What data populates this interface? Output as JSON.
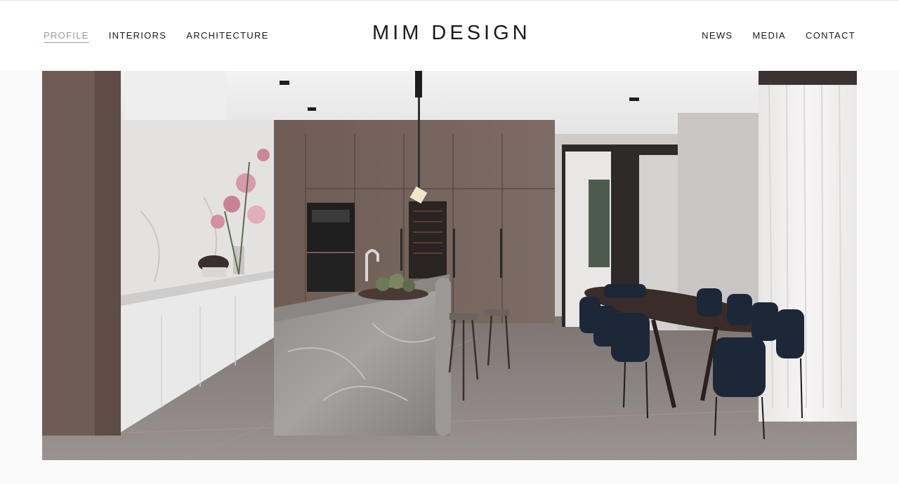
{
  "brand": {
    "logo_text": "MIM DESIGN"
  },
  "nav": {
    "left": [
      {
        "label": "PROFILE",
        "active": true
      },
      {
        "label": "INTERIORS",
        "active": false
      },
      {
        "label": "ARCHITECTURE",
        "active": false
      }
    ],
    "right": [
      {
        "label": "NEWS"
      },
      {
        "label": "MEDIA"
      },
      {
        "label": "CONTACT"
      }
    ]
  },
  "hero": {
    "image_subject": "kitchen-and-dining-interior"
  },
  "colors": {
    "accent_underline": "#b89a7e",
    "active_link": "#9a9a9a",
    "text": "#1a1a1a"
  }
}
